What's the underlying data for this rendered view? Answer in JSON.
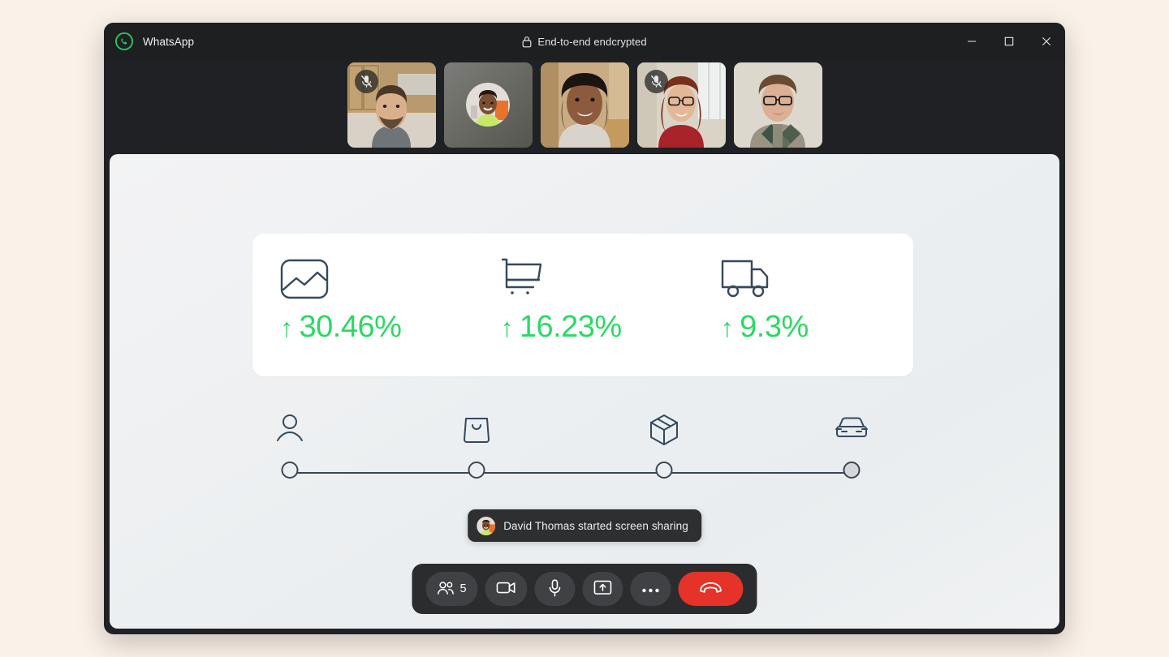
{
  "window": {
    "app_title": "WhatsApp",
    "logo_icon": "whatsapp-logo-icon",
    "encryption_label": "End-to-end endcrypted",
    "lock_icon": "lock-icon",
    "controls": {
      "minimize": "minimize-icon",
      "maximize": "maximize-icon",
      "close": "close-icon"
    }
  },
  "filmstrip": {
    "participants": [
      {
        "name": "participant-1",
        "muted": true,
        "camera_on": true,
        "skin": "#d9b08c",
        "bg": "#b08f62",
        "shirt": "#6f7478",
        "hair": "#4a3728"
      },
      {
        "name": "David Thomas",
        "muted": false,
        "camera_on": false,
        "skin": "#7a4e30",
        "bg": "#6e6f63",
        "shirt": "#c8e86b",
        "hair": "#241a12"
      },
      {
        "name": "participant-3",
        "muted": false,
        "camera_on": true,
        "skin": "#8c5a3c",
        "bg": "#c3a887",
        "shirt": "#d8d4cc",
        "hair": "#1b1410"
      },
      {
        "name": "participant-4",
        "muted": true,
        "camera_on": true,
        "skin": "#e2b899",
        "bg": "#d8d2c6",
        "shirt": "#a8232a",
        "hair": "#7a2f1c"
      },
      {
        "name": "participant-5",
        "muted": false,
        "camera_on": true,
        "skin": "#dbb095",
        "bg": "#ddd8cd",
        "shirt": "#9a9384",
        "hair": "#6b4a33"
      }
    ]
  },
  "stage": {
    "metrics": [
      {
        "icon": "chart-image-icon",
        "arrow": "↑",
        "value": "30.46%"
      },
      {
        "icon": "shopping-cart-icon",
        "arrow": "↑",
        "value": "16.23%"
      },
      {
        "icon": "delivery-truck-icon",
        "arrow": "↑",
        "value": "9.3%"
      }
    ],
    "accent_color": "#2bd964",
    "icon_color": "#34495e",
    "timeline": {
      "steps": [
        {
          "icon": "person-icon",
          "node": "open"
        },
        {
          "icon": "shopping-bag-icon",
          "node": "open"
        },
        {
          "icon": "package-box-icon",
          "node": "open"
        },
        {
          "icon": "car-icon",
          "node": "filled"
        }
      ]
    },
    "toast": {
      "avatar_icon": "david-thomas-avatar",
      "message": "David Thomas started screen sharing"
    },
    "controls": [
      {
        "name": "participants-button",
        "icon": "people-icon",
        "count": "5"
      },
      {
        "name": "camera-button",
        "icon": "video-camera-icon",
        "count": ""
      },
      {
        "name": "microphone-button",
        "icon": "microphone-icon",
        "count": ""
      },
      {
        "name": "share-screen-button",
        "icon": "share-screen-icon",
        "count": ""
      },
      {
        "name": "more-options-button",
        "icon": "ellipsis-icon",
        "count": ""
      },
      {
        "name": "end-call-button",
        "icon": "hang-up-icon",
        "count": ""
      }
    ]
  }
}
